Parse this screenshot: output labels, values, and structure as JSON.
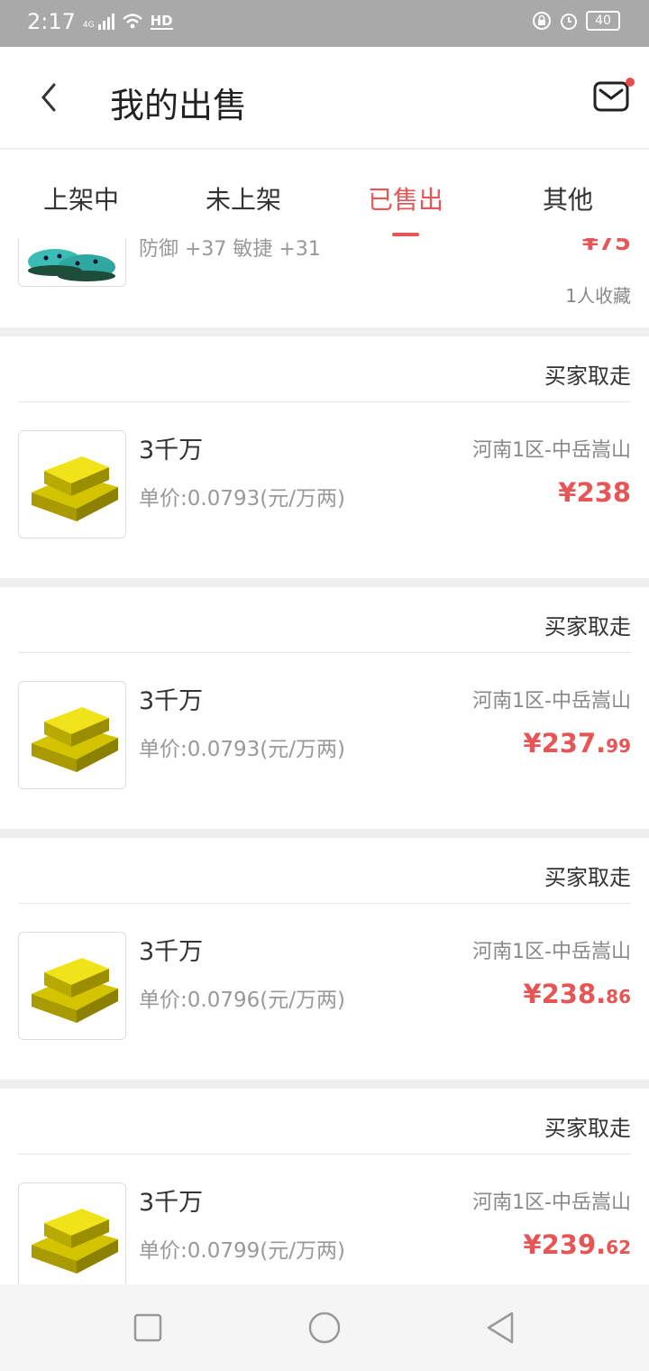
{
  "status_bar": {
    "time": "2:17",
    "network": "4G",
    "hd": "HD",
    "battery": "40"
  },
  "header": {
    "title": "我的出售"
  },
  "tabs": [
    {
      "label": "上架中",
      "active": false
    },
    {
      "label": "未上架",
      "active": false
    },
    {
      "label": "已售出",
      "active": true
    },
    {
      "label": "其他",
      "active": false
    }
  ],
  "partial_item": {
    "stats": "防御 +37 敏捷 +31",
    "price": "¥75",
    "favorites": "1人收藏"
  },
  "orders": [
    {
      "status": "买家取走",
      "amount": "3千万",
      "unit_price": "单价:0.0793(元/万两)",
      "server": "河南1区-中岳嵩山",
      "price_int": "¥238",
      "price_dec": ""
    },
    {
      "status": "买家取走",
      "amount": "3千万",
      "unit_price": "单价:0.0793(元/万两)",
      "server": "河南1区-中岳嵩山",
      "price_int": "¥237.",
      "price_dec": "99"
    },
    {
      "status": "买家取走",
      "amount": "3千万",
      "unit_price": "单价:0.0796(元/万两)",
      "server": "河南1区-中岳嵩山",
      "price_int": "¥238.",
      "price_dec": "86"
    },
    {
      "status": "买家取走",
      "amount": "3千万",
      "unit_price": "单价:0.0799(元/万两)",
      "server": "河南1区-中岳嵩山",
      "price_int": "¥239.",
      "price_dec": "62"
    }
  ],
  "colors": {
    "accent": "#e65656",
    "status_bar": "#a9a9a9",
    "page_bg": "#eeeeee"
  },
  "icons": {
    "back": "chevron-left-icon",
    "mail": "mail-icon",
    "nav_recent": "square-icon",
    "nav_home": "circle-icon",
    "nav_back": "triangle-back-icon"
  }
}
